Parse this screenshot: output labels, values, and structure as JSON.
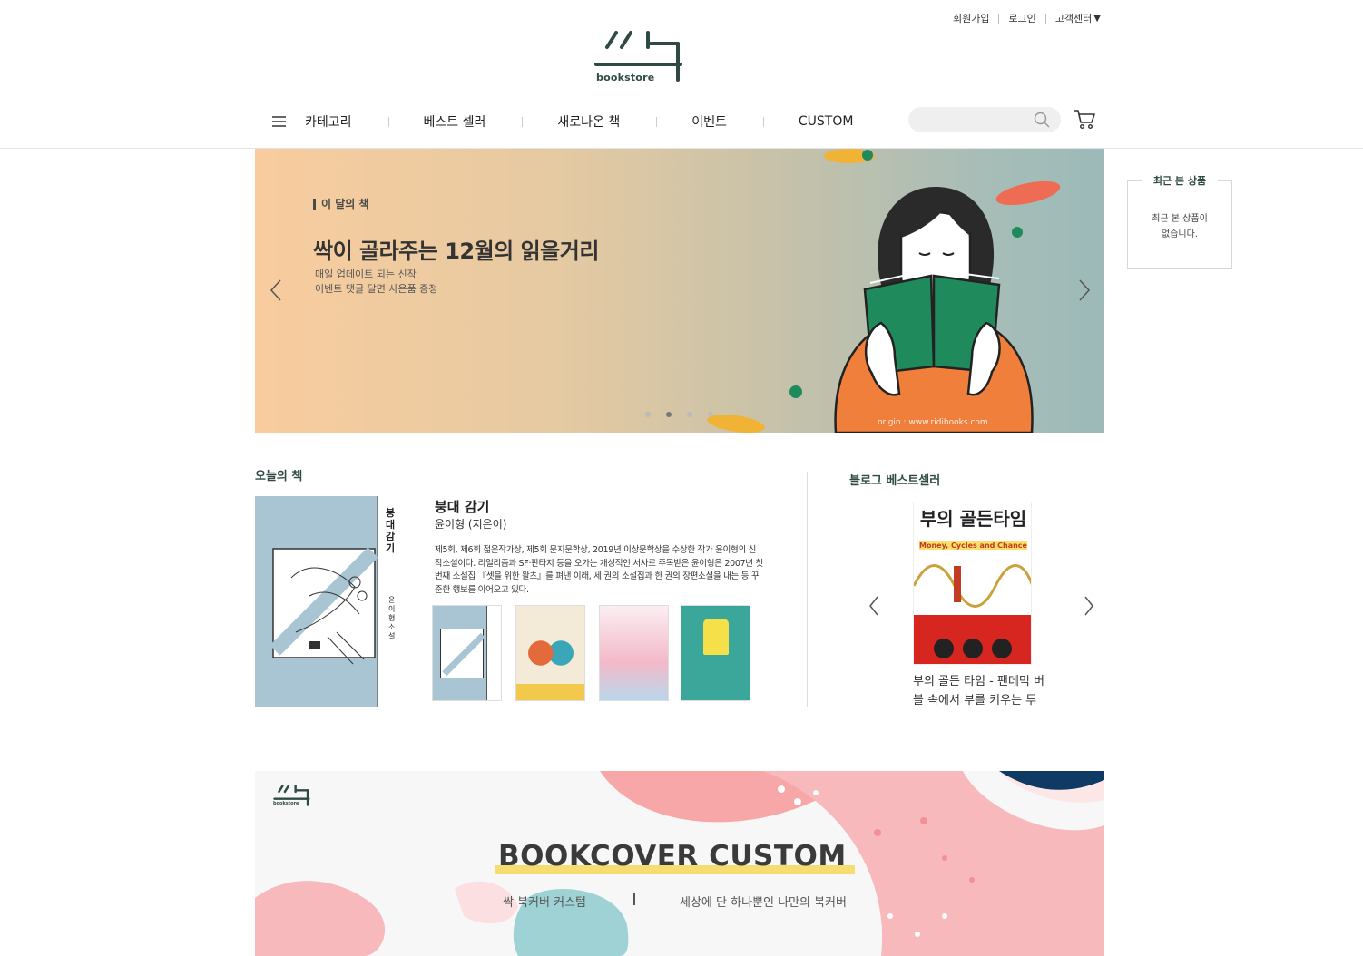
{
  "util": {
    "signup": "회원가입",
    "login": "로그인",
    "support": "고객센터"
  },
  "logo": {
    "text": "bookstore"
  },
  "nav": {
    "items": [
      "카테고리",
      "베스트 셀러",
      "새로나온 책",
      "이벤트",
      "CUSTOM"
    ]
  },
  "search": {
    "placeholder": ""
  },
  "hero": {
    "tag": "이 달의 책",
    "title": "싹이 골라주는 12월의 읽을거리",
    "sub1": "매일 업데이트 되는 신작",
    "sub2": "이벤트 댓글 달면 사은품 증정",
    "origin": "origin : www.ridibooks.com",
    "slide_count": 4,
    "active_slide": 2
  },
  "recent": {
    "title": "최근 본 상품",
    "empty_line1": "최근 본 상품이",
    "empty_line2": "없습니다."
  },
  "today": {
    "section_title": "오늘의 책",
    "book_title": "붕대 감기",
    "author": "윤이형 (지은이)",
    "description": "제5회, 제6회 젊은작가상, 제5회 문지문학상, 2019년 이상문학상을 수상한 작가 윤이형의 신작소설이다. 리얼리즘과 SF·판타지 등을 오가는 개성적인 서사로 주목받은 윤이형은 2007년 첫 번째 소설집 『셋을 위한 왈츠』를 펴낸 이래, 세 권의 소설집과 한 권의 장편소설을 내는 등 꾸준한 행보를 이어오고 있다.",
    "cover_title": "붕대 감기",
    "cover_author": "윤이형 소설"
  },
  "blog": {
    "section_title": "블로그 베스트셀러",
    "cover_title": "부의 골든타임",
    "cover_sub": "Money, Cycles and Chance",
    "caption": "부의 골든 타임 - 팬데믹 버블 속에서 부를 키우는 투"
  },
  "custom": {
    "title": "BOOKCOVER CUSTOM",
    "sub_left": "싹 북커버 커스텀",
    "sub_right": "세상에 단 하나뿐인 나만의 북커버",
    "logo_text": "bookstore"
  },
  "colors": {
    "brand": "#2f4a44",
    "accent_green": "#1f8a5c",
    "accent_orange": "#f07f3c"
  }
}
